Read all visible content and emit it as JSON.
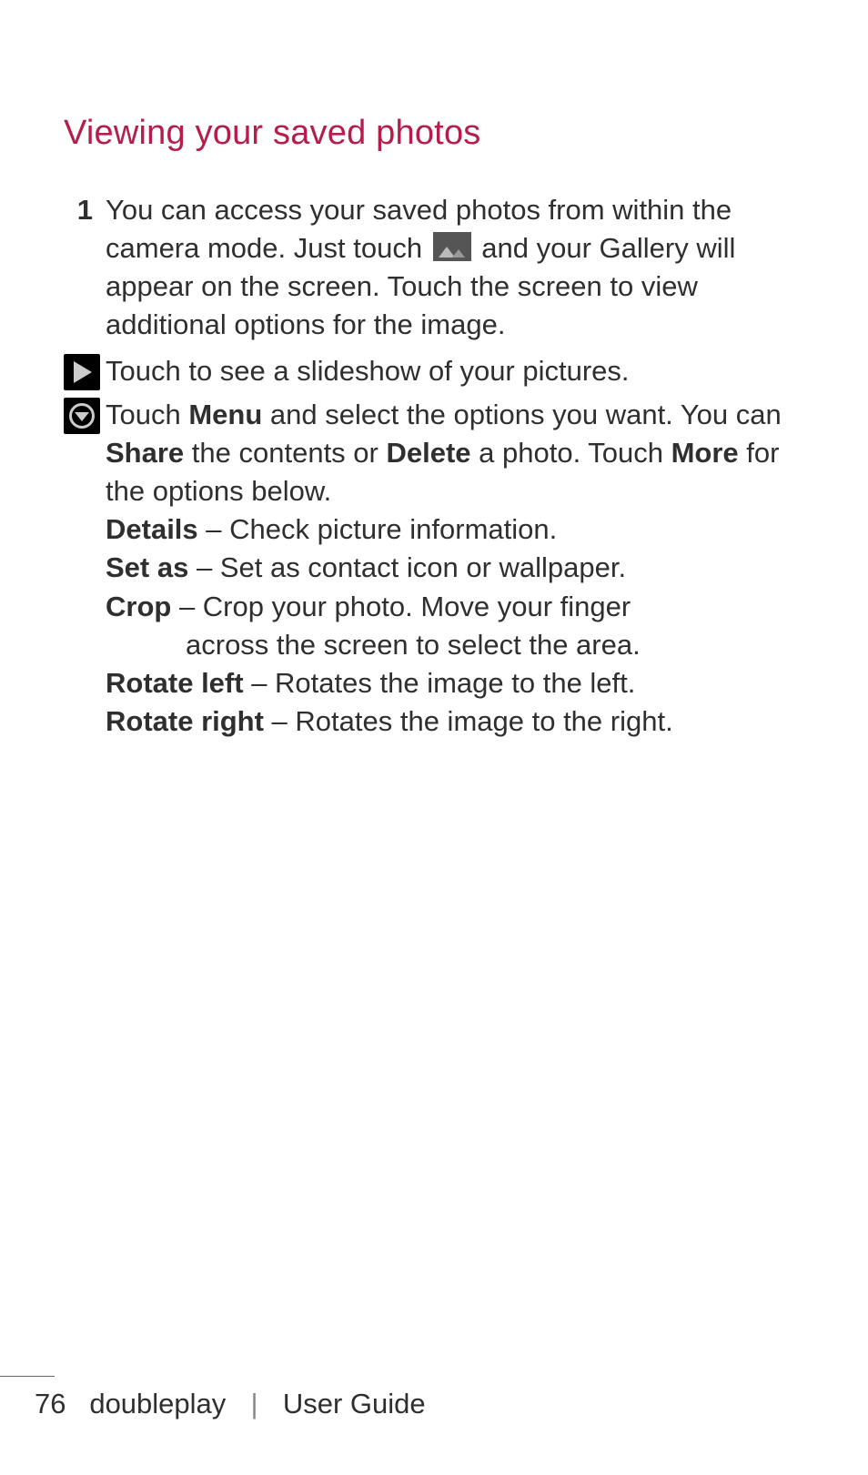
{
  "heading": "Viewing your saved photos",
  "step1_num": "1",
  "step1_pre": "You can access your saved photos from within the camera mode. Just touch ",
  "step1_post": " and your Gallery will appear on the screen. Touch the screen to view additional options for the image.",
  "slideshow_text": "Touch to see a slideshow of your pictures.",
  "menu_p1": "Touch ",
  "menu_b1": "Menu",
  "menu_p2": " and select the options you want. You can ",
  "menu_b2": "Share",
  "menu_p3": " the contents or ",
  "menu_b3": "Delete",
  "menu_p4": " a photo. Touch ",
  "menu_b4": "More",
  "menu_p5": " for the options below.",
  "opt_details_b": "Details",
  "opt_details_t": " – Check picture information.",
  "opt_setas_b": "Set as",
  "opt_setas_t": " – Set as contact icon or wallpaper.",
  "opt_crop_b": "Crop",
  "opt_crop_t": " – Crop your photo. Move your finger",
  "opt_crop_sub": "across the screen to select the area.",
  "opt_rotl_b": "Rotate left",
  "opt_rotl_t": " – Rotates the image to the left.",
  "opt_rotr_b": "Rotate right",
  "opt_rotr_t": " – Rotates the image to the right.",
  "footer_page": "76",
  "footer_product": "doubleplay",
  "footer_sep": "|",
  "footer_guide": "User Guide"
}
